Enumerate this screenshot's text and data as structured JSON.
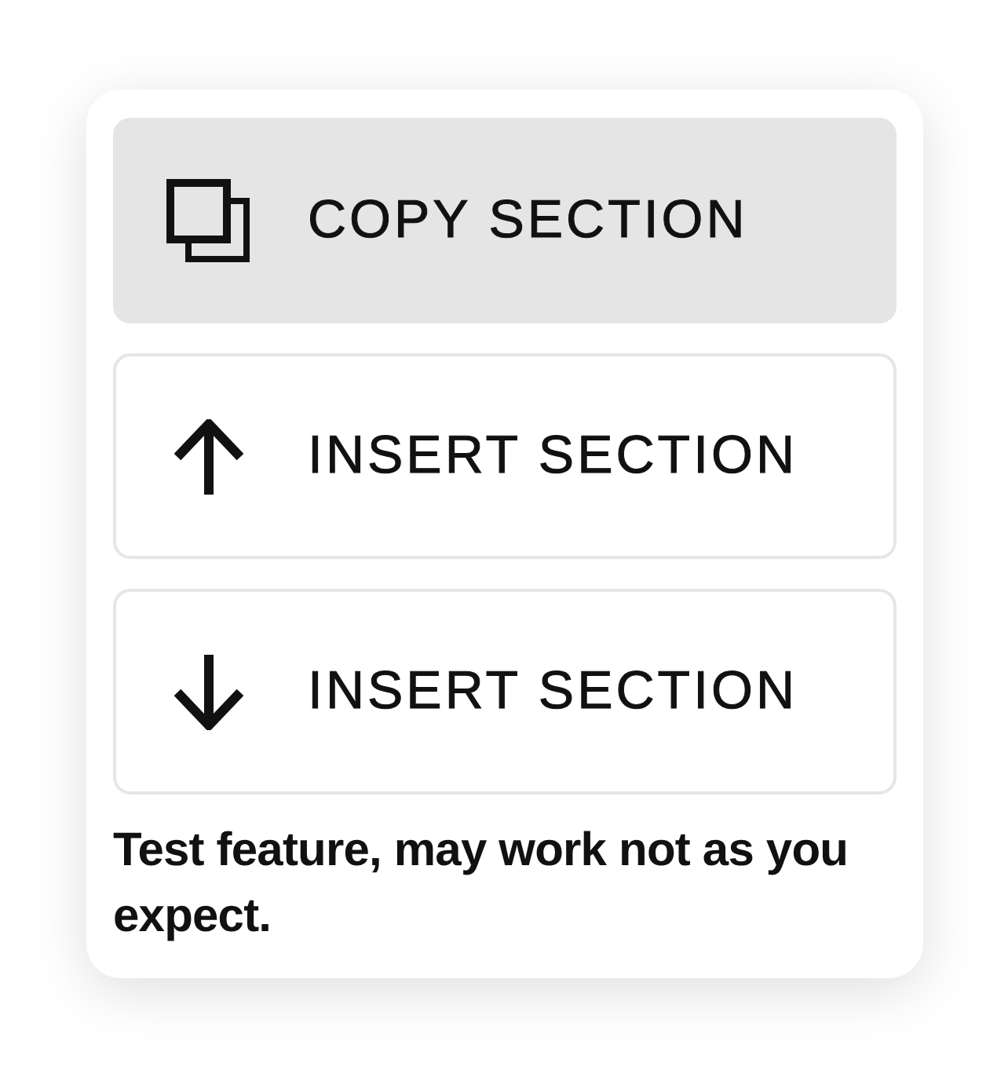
{
  "menu": {
    "items": [
      {
        "kind": "copy",
        "label": "COPY SECTION",
        "selected": true
      },
      {
        "kind": "insert_above",
        "label": "INSERT SECTION",
        "selected": false
      },
      {
        "kind": "insert_below",
        "label": "INSERT SECTION",
        "selected": false
      }
    ],
    "note": "Test feature, may work not as you expect."
  }
}
